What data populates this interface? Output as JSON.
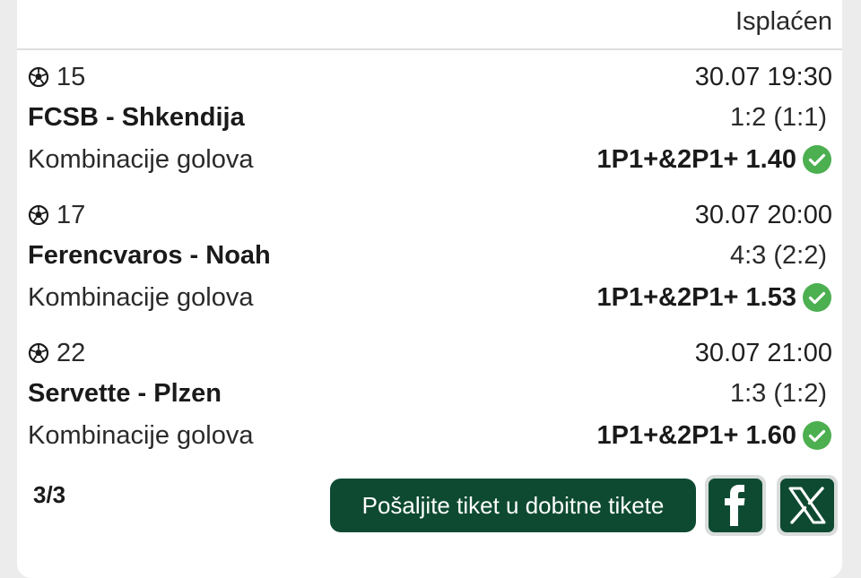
{
  "ticket": {
    "status": "Isplaćen",
    "matches": [
      {
        "number": "15",
        "datetime": "30.07 19:30",
        "teams": "FCSB - Shkendija",
        "score": "1:2 (1:1)",
        "market": "Kombinacije golova",
        "pick": "1P1+&2P1+ 1.40",
        "won": true
      },
      {
        "number": "17",
        "datetime": "30.07 20:00",
        "teams": "Ferencvaros - Noah",
        "score": "4:3 (2:2)",
        "market": "Kombinacije golova",
        "pick": "1P1+&2P1+ 1.53",
        "won": true
      },
      {
        "number": "22",
        "datetime": "30.07 21:00",
        "teams": "Servette - Plzen",
        "score": "1:3 (1:2)",
        "market": "Kombinacije golova",
        "pick": "1P1+&2P1+ 1.60",
        "won": true
      }
    ],
    "count": "3/3",
    "send_button": "Pošaljite tiket u dobitne tikete",
    "sport_icon": "soccer-ball-icon",
    "status_icon": "green-check-icon",
    "share_icons": [
      "facebook-icon",
      "x-icon"
    ]
  },
  "colors": {
    "brand_green": "#0e4a32",
    "win_green": "#4caf50",
    "background": "#ececec",
    "card": "#ffffff"
  }
}
